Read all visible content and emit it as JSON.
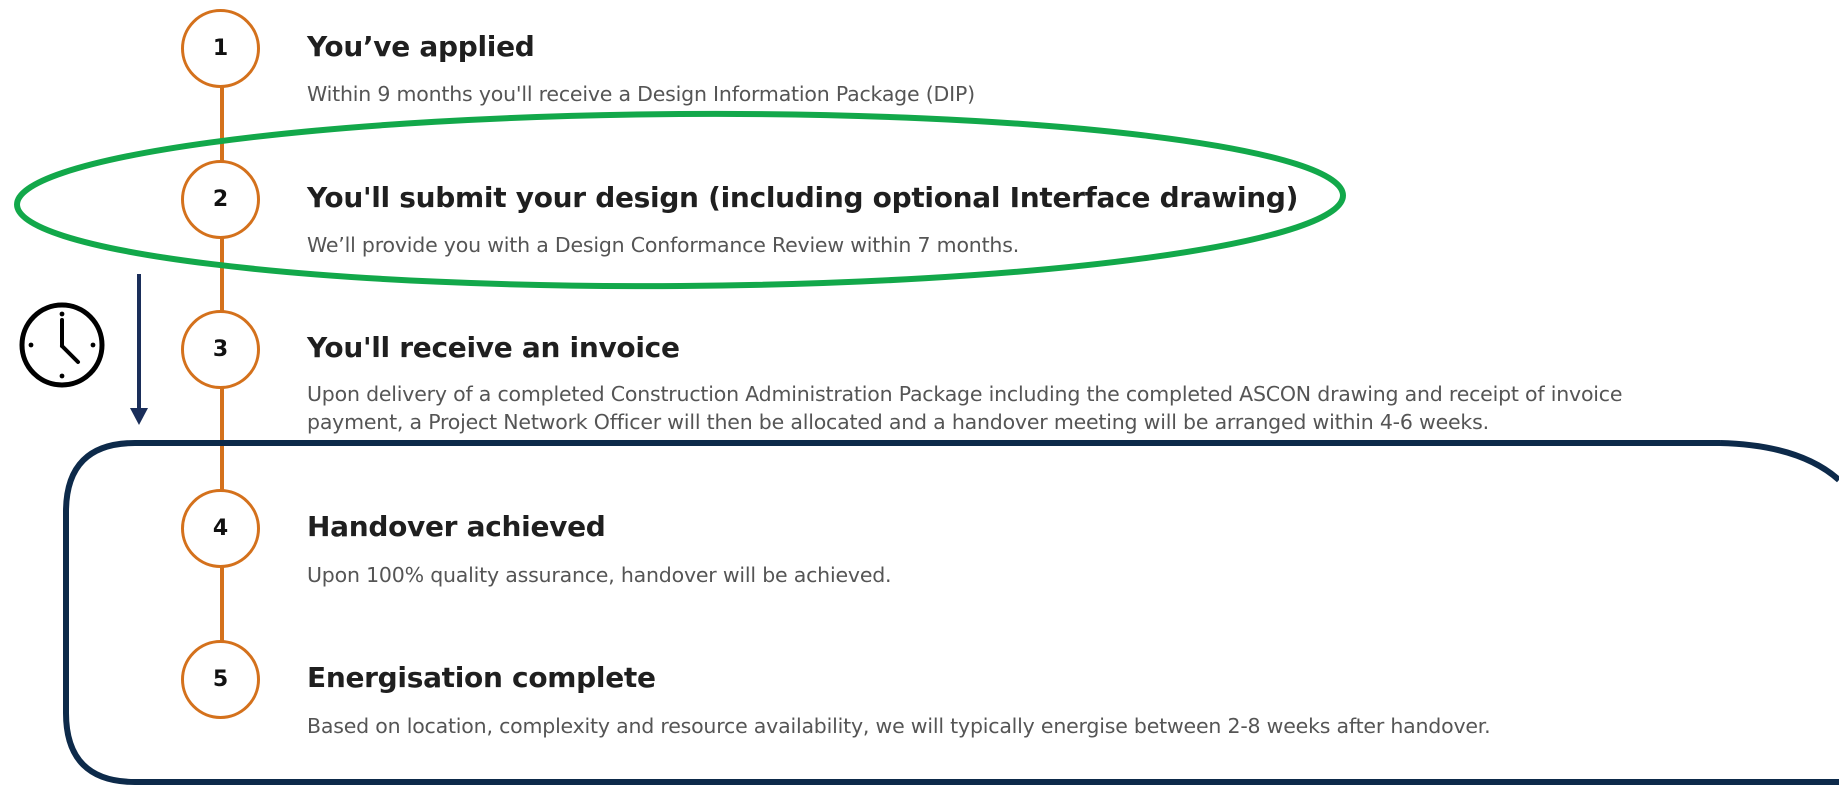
{
  "steps": [
    {
      "number": "1",
      "title": "You’ve applied",
      "description": "Within 9 months you'll receive a Design Information Package (DIP)"
    },
    {
      "number": "2",
      "title": "You'll submit your design (including optional Interface drawing)",
      "description": "We’ll provide you with a Design Conformance Review within 7 months."
    },
    {
      "number": "3",
      "title": "You'll receive an invoice",
      "description_lines": [
        "Upon delivery of a completed Construction Administration Package including the completed ASCON drawing and receipt of invoice",
        "payment, a Project Network Officer will then be allocated and a handover meeting will be arranged within 4-6 weeks."
      ]
    },
    {
      "number": "4",
      "title": "Handover achieved",
      "description": "Upon 100% quality assurance, handover will be achieved."
    },
    {
      "number": "5",
      "title": "Energisation complete",
      "description": "Based on location, complexity and resource availability, we will typically energise between 2-8 weeks after handover."
    }
  ],
  "colors": {
    "timeline": "#d4711c",
    "highlight_ellipse": "#12a84a",
    "highlight_box": "#0d2a4a",
    "arrow": "#1a2e5a",
    "clock": "#000000"
  },
  "icons": {
    "clock": "clock-icon",
    "arrow": "arrow-down-icon"
  }
}
